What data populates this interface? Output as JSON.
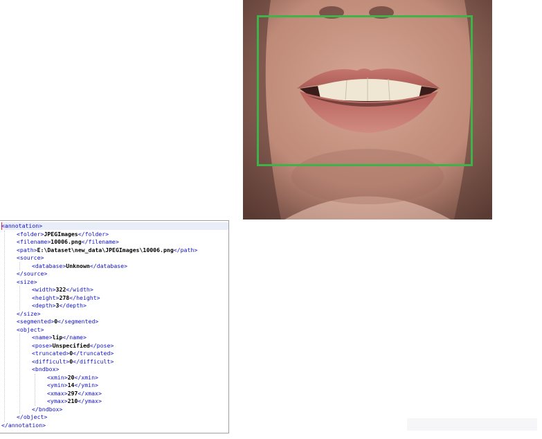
{
  "colors": {
    "bbox_stroke": "#3fb34a",
    "xml_tag": "#1212c8",
    "xml_value": "#000000"
  },
  "xml": {
    "lines": [
      {
        "indent": 0,
        "open": "<annotation>",
        "value": "",
        "close": ""
      },
      {
        "indent": 1,
        "open": "<folder>",
        "value": "JPEGImages",
        "close": "</folder>"
      },
      {
        "indent": 1,
        "open": "<filename>",
        "value": "10006.png",
        "close": "</filename>"
      },
      {
        "indent": 1,
        "open": "<path>",
        "value": "E:\\Dataset\\new_data\\JPEGImages\\10006.png",
        "close": "</path>"
      },
      {
        "indent": 1,
        "open": "<source>",
        "value": "",
        "close": ""
      },
      {
        "indent": 2,
        "open": "<database>",
        "value": "Unknown",
        "close": "</database>"
      },
      {
        "indent": 1,
        "open": "</source>",
        "value": "",
        "close": ""
      },
      {
        "indent": 1,
        "open": "<size>",
        "value": "",
        "close": ""
      },
      {
        "indent": 2,
        "open": "<width>",
        "value": "322",
        "close": "</width>"
      },
      {
        "indent": 2,
        "open": "<height>",
        "value": "278",
        "close": "</height>"
      },
      {
        "indent": 2,
        "open": "<depth>",
        "value": "3",
        "close": "</depth>"
      },
      {
        "indent": 1,
        "open": "</size>",
        "value": "",
        "close": ""
      },
      {
        "indent": 1,
        "open": "<segmented>",
        "value": "0",
        "close": "</segmented>"
      },
      {
        "indent": 1,
        "open": "<object>",
        "value": "",
        "close": ""
      },
      {
        "indent": 2,
        "open": "<name>",
        "value": "lip",
        "close": "</name>"
      },
      {
        "indent": 2,
        "open": "<pose>",
        "value": "Unspecified",
        "close": "</pose>"
      },
      {
        "indent": 2,
        "open": "<truncated>",
        "value": "0",
        "close": "</truncated>"
      },
      {
        "indent": 2,
        "open": "<difficult>",
        "value": "0",
        "close": "</difficult>"
      },
      {
        "indent": 2,
        "open": "<bndbox>",
        "value": "",
        "close": ""
      },
      {
        "indent": 3,
        "open": "<xmin>",
        "value": "20",
        "close": "</xmin>"
      },
      {
        "indent": 3,
        "open": "<ymin>",
        "value": "14",
        "close": "</ymin>"
      },
      {
        "indent": 3,
        "open": "<xmax>",
        "value": "297",
        "close": "</xmax>"
      },
      {
        "indent": 3,
        "open": "<ymax>",
        "value": "210",
        "close": "</ymax>"
      },
      {
        "indent": 2,
        "open": "</bndbox>",
        "value": "",
        "close": ""
      },
      {
        "indent": 1,
        "open": "</object>",
        "value": "",
        "close": ""
      },
      {
        "indent": 0,
        "open": "</annotation>",
        "value": "",
        "close": ""
      }
    ]
  }
}
